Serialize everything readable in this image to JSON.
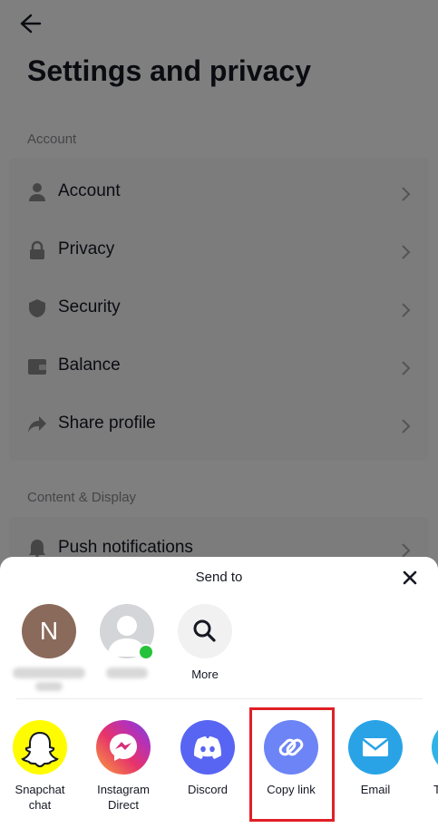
{
  "settings": {
    "title": "Settings and privacy",
    "sections": [
      {
        "label": "Account",
        "items": [
          "Account",
          "Privacy",
          "Security",
          "Balance",
          "Share profile"
        ]
      },
      {
        "label": "Content & Display",
        "items": [
          "Push notifications"
        ]
      }
    ]
  },
  "share_sheet": {
    "title": "Send to",
    "contacts": [
      {
        "initial": "N"
      },
      {
        "online": true
      },
      {
        "label": "More"
      }
    ],
    "apps": [
      {
        "label_line1": "Snapchat",
        "label_line2": "chat",
        "color": "#fffc00"
      },
      {
        "label_line1": "Instagram",
        "label_line2": "Direct",
        "color": "#d6249f"
      },
      {
        "label_line1": "Discord",
        "label_line2": "",
        "color": "#5865f2"
      },
      {
        "label_line1": "Copy link",
        "label_line2": "",
        "color": "#6c84f5"
      },
      {
        "label_line1": "Email",
        "label_line2": "",
        "color": "#29a3e6"
      },
      {
        "label_line1": "T",
        "label_line2": "",
        "color": "#30b3e6"
      }
    ]
  },
  "colors": {
    "highlight": "#e01f26",
    "text": "#161823"
  }
}
